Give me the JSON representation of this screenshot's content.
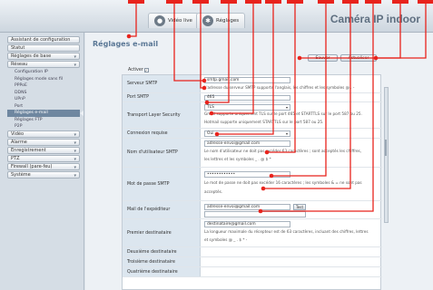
{
  "header": {
    "brand": "Caméra IP indoor",
    "tabs": [
      {
        "label": "Vidéo live",
        "icon": "video-camera-icon"
      },
      {
        "label": "Réglages",
        "icon": "gear-icon"
      }
    ]
  },
  "sidebar": {
    "items": [
      {
        "label": "Assistant de configuration",
        "type": "head",
        "chevron": false
      },
      {
        "label": "Statut",
        "type": "head",
        "chevron": false
      },
      {
        "label": "Réglages de base",
        "type": "head",
        "chevron": true
      },
      {
        "label": "Réseau",
        "type": "head",
        "chevron": true
      },
      {
        "label": "Configuration IP",
        "type": "sub"
      },
      {
        "label": "Réglages mode sans fil",
        "type": "sub"
      },
      {
        "label": "PPPoE",
        "type": "sub"
      },
      {
        "label": "DDNS",
        "type": "sub"
      },
      {
        "label": "UPnP",
        "type": "sub"
      },
      {
        "label": "Port",
        "type": "sub"
      },
      {
        "label": "Réglages e-mail",
        "type": "sub",
        "active": true
      },
      {
        "label": "Réglages FTP",
        "type": "sub"
      },
      {
        "label": "P2P",
        "type": "sub"
      },
      {
        "label": "Vidéo",
        "type": "head",
        "chevron": true
      },
      {
        "label": "Alarme",
        "type": "head",
        "chevron": true
      },
      {
        "label": "Enregistrement",
        "type": "head",
        "chevron": true
      },
      {
        "label": "PTZ",
        "type": "head",
        "chevron": true
      },
      {
        "label": "Firewall (pare-feu)",
        "type": "head",
        "chevron": true
      },
      {
        "label": "Système",
        "type": "head",
        "chevron": true
      }
    ]
  },
  "main": {
    "title": "Réglages e-mail",
    "save_label": "Sauver",
    "refresh_label": "Actualiser",
    "activer_label": "Activer",
    "activer_checked": "✓",
    "fields": {
      "smtp_server": {
        "label": "Serveur SMTP",
        "value": "smtp.gmail.com",
        "hint": "L'adresse du serveur SMTP supporte l'anglais, les chiffres et les symboles @ . -"
      },
      "smtp_port": {
        "label": "Port SMTP",
        "value": "465"
      },
      "tls": {
        "label": "Transport Layer Security",
        "value": "TLS",
        "hint1": "Gmail supporte uniquement TLS sur le port 465 et STARTTLS sur le port 587 ou 25.",
        "hint2": "Hotmail supporte uniquement STARTTLS sur le port 587 ou 25."
      },
      "login": {
        "label": "Connexion requise",
        "value": "Oui"
      },
      "username": {
        "label": "Nom d'utilisateur SMTP",
        "value": "adresse-envoi@gmail.com",
        "hint1": "Le nom d'utilisateur ne doit pas excéder 63 caractères ; sont acceptés les chiffres,",
        "hint2": "les lettres et les symboles _ . @ $ *"
      },
      "password": {
        "label": "Mot de passe SMTP",
        "value": "••••••••••••",
        "hint1": "Le mot de passe ne doit pas excéder 16 caractères ; les symboles & = ne sont pas",
        "hint2": "acceptés."
      },
      "sender": {
        "label": "Mail de l'expéditeur",
        "value": "adresse-envoi@gmail.com",
        "test_label": "Test"
      },
      "recipient1": {
        "label": "Premier destinataire",
        "value": "destinataire@gmail.com",
        "hint1": "La longueur maximale du récepteur est de 63 caractères, incluant des chiffres, lettres",
        "hint2": "et symboles @ _ . $ * -"
      },
      "recipient2": {
        "label": "Deuxième destinataire"
      },
      "recipient3": {
        "label": "Troisième destinataire"
      },
      "recipient4": {
        "label": "Quatrième destinataire"
      }
    }
  },
  "colors": {
    "annotation": "#e8231c",
    "title": "#5b7896",
    "active_item": "#6f87a0"
  }
}
